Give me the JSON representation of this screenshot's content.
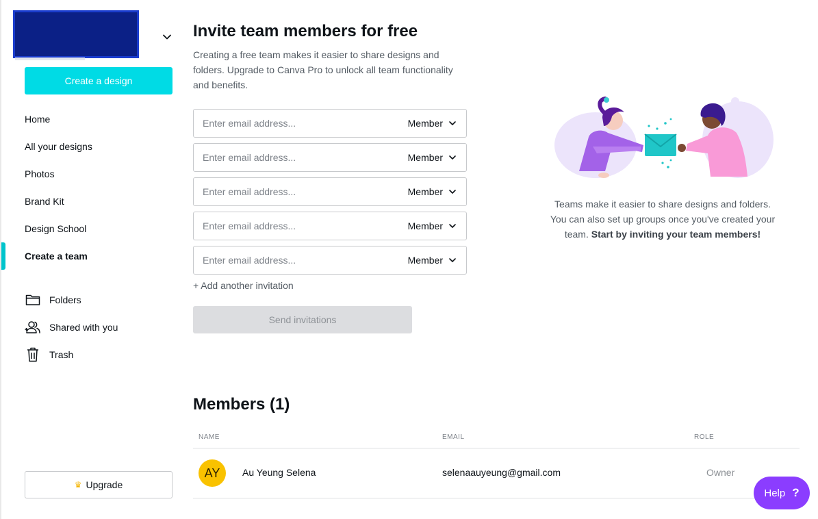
{
  "sidebar": {
    "create_label": "Create a design",
    "nav_items": [
      {
        "label": "Home"
      },
      {
        "label": "All your designs"
      },
      {
        "label": "Photos"
      },
      {
        "label": "Brand Kit"
      },
      {
        "label": "Design School"
      },
      {
        "label": "Create a team",
        "active": true
      }
    ],
    "secondary_items": [
      {
        "label": "Folders",
        "icon": "folder-icon"
      },
      {
        "label": "Shared with you",
        "icon": "shared-users-icon"
      },
      {
        "label": "Trash",
        "icon": "trash-icon"
      }
    ],
    "upgrade_label": "Upgrade"
  },
  "invite": {
    "title": "Invite team members for free",
    "description": "Creating a free team makes it easier to share designs and folders. Upgrade to Canva Pro to unlock all team functionality and benefits.",
    "email_placeholder": "Enter email address...",
    "rows": [
      {
        "role": "Member"
      },
      {
        "role": "Member"
      },
      {
        "role": "Member"
      },
      {
        "role": "Member"
      },
      {
        "role": "Member"
      }
    ],
    "add_label": "+ Add another invitation",
    "send_label": "Send invitations"
  },
  "side_info": {
    "text": "Teams make it easier to share designs and folders. You can also set up groups once you've created your team.",
    "bold": "Start by inviting your team members!"
  },
  "members": {
    "title": "Members (1)",
    "columns": [
      "NAME",
      "EMAIL",
      "ROLE"
    ],
    "rows": [
      {
        "initials": "AY",
        "name": "Au Yeung Selena",
        "email": "selenaauyeung@gmail.com",
        "role": "Owner"
      }
    ]
  },
  "help": {
    "label": "Help",
    "icon_text": "?"
  },
  "colors": {
    "accent": "#00dbe5",
    "help": "#8b3dff",
    "avatar": "#f9c200",
    "brand_box": "#0b2086"
  }
}
